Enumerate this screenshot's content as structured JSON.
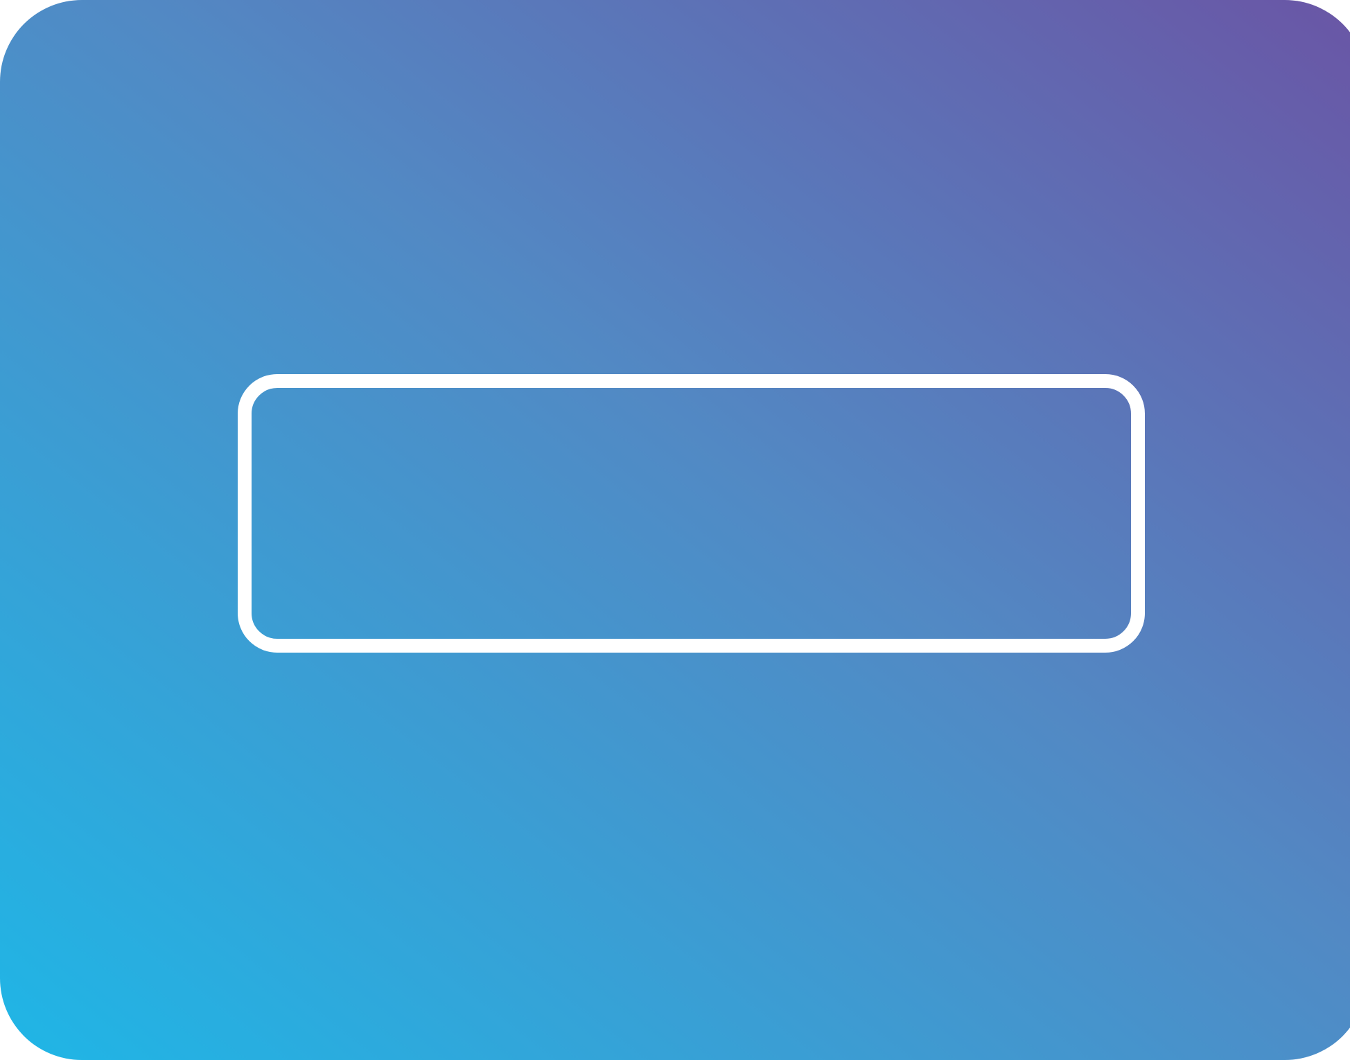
{
  "colors": {
    "gradient_start": "#1fb6e6",
    "gradient_mid": "#5289c4",
    "gradient_end": "#6a55a5",
    "outline": "#ffffff"
  },
  "icon": {
    "tile": "rounded-gradient-tile",
    "shape": "text-field-outline-icon"
  }
}
